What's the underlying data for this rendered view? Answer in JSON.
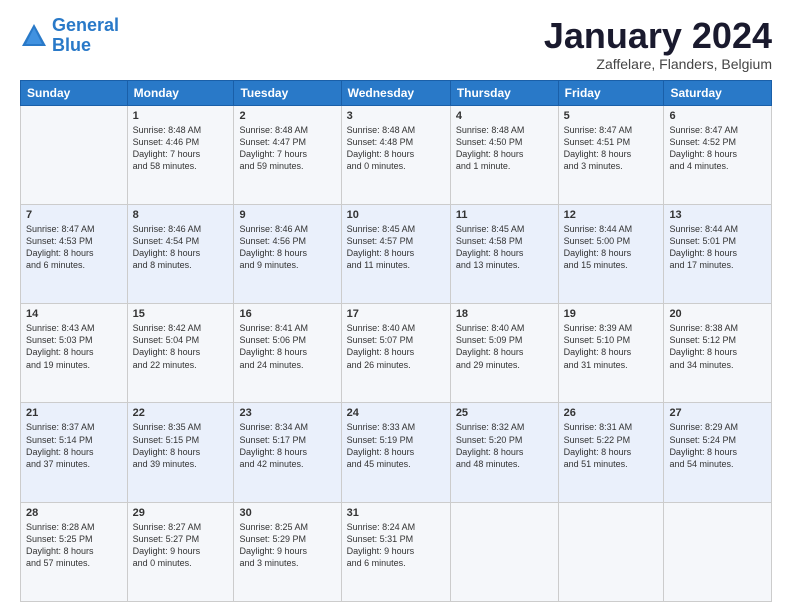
{
  "logo": {
    "line1": "General",
    "line2": "Blue"
  },
  "header": {
    "month": "January 2024",
    "location": "Zaffelare, Flanders, Belgium"
  },
  "weekdays": [
    "Sunday",
    "Monday",
    "Tuesday",
    "Wednesday",
    "Thursday",
    "Friday",
    "Saturday"
  ],
  "weeks": [
    [
      {
        "day": "",
        "info": ""
      },
      {
        "day": "1",
        "info": "Sunrise: 8:48 AM\nSunset: 4:46 PM\nDaylight: 7 hours\nand 58 minutes."
      },
      {
        "day": "2",
        "info": "Sunrise: 8:48 AM\nSunset: 4:47 PM\nDaylight: 7 hours\nand 59 minutes."
      },
      {
        "day": "3",
        "info": "Sunrise: 8:48 AM\nSunset: 4:48 PM\nDaylight: 8 hours\nand 0 minutes."
      },
      {
        "day": "4",
        "info": "Sunrise: 8:48 AM\nSunset: 4:50 PM\nDaylight: 8 hours\nand 1 minute."
      },
      {
        "day": "5",
        "info": "Sunrise: 8:47 AM\nSunset: 4:51 PM\nDaylight: 8 hours\nand 3 minutes."
      },
      {
        "day": "6",
        "info": "Sunrise: 8:47 AM\nSunset: 4:52 PM\nDaylight: 8 hours\nand 4 minutes."
      }
    ],
    [
      {
        "day": "7",
        "info": "Sunrise: 8:47 AM\nSunset: 4:53 PM\nDaylight: 8 hours\nand 6 minutes."
      },
      {
        "day": "8",
        "info": "Sunrise: 8:46 AM\nSunset: 4:54 PM\nDaylight: 8 hours\nand 8 minutes."
      },
      {
        "day": "9",
        "info": "Sunrise: 8:46 AM\nSunset: 4:56 PM\nDaylight: 8 hours\nand 9 minutes."
      },
      {
        "day": "10",
        "info": "Sunrise: 8:45 AM\nSunset: 4:57 PM\nDaylight: 8 hours\nand 11 minutes."
      },
      {
        "day": "11",
        "info": "Sunrise: 8:45 AM\nSunset: 4:58 PM\nDaylight: 8 hours\nand 13 minutes."
      },
      {
        "day": "12",
        "info": "Sunrise: 8:44 AM\nSunset: 5:00 PM\nDaylight: 8 hours\nand 15 minutes."
      },
      {
        "day": "13",
        "info": "Sunrise: 8:44 AM\nSunset: 5:01 PM\nDaylight: 8 hours\nand 17 minutes."
      }
    ],
    [
      {
        "day": "14",
        "info": "Sunrise: 8:43 AM\nSunset: 5:03 PM\nDaylight: 8 hours\nand 19 minutes."
      },
      {
        "day": "15",
        "info": "Sunrise: 8:42 AM\nSunset: 5:04 PM\nDaylight: 8 hours\nand 22 minutes."
      },
      {
        "day": "16",
        "info": "Sunrise: 8:41 AM\nSunset: 5:06 PM\nDaylight: 8 hours\nand 24 minutes."
      },
      {
        "day": "17",
        "info": "Sunrise: 8:40 AM\nSunset: 5:07 PM\nDaylight: 8 hours\nand 26 minutes."
      },
      {
        "day": "18",
        "info": "Sunrise: 8:40 AM\nSunset: 5:09 PM\nDaylight: 8 hours\nand 29 minutes."
      },
      {
        "day": "19",
        "info": "Sunrise: 8:39 AM\nSunset: 5:10 PM\nDaylight: 8 hours\nand 31 minutes."
      },
      {
        "day": "20",
        "info": "Sunrise: 8:38 AM\nSunset: 5:12 PM\nDaylight: 8 hours\nand 34 minutes."
      }
    ],
    [
      {
        "day": "21",
        "info": "Sunrise: 8:37 AM\nSunset: 5:14 PM\nDaylight: 8 hours\nand 37 minutes."
      },
      {
        "day": "22",
        "info": "Sunrise: 8:35 AM\nSunset: 5:15 PM\nDaylight: 8 hours\nand 39 minutes."
      },
      {
        "day": "23",
        "info": "Sunrise: 8:34 AM\nSunset: 5:17 PM\nDaylight: 8 hours\nand 42 minutes."
      },
      {
        "day": "24",
        "info": "Sunrise: 8:33 AM\nSunset: 5:19 PM\nDaylight: 8 hours\nand 45 minutes."
      },
      {
        "day": "25",
        "info": "Sunrise: 8:32 AM\nSunset: 5:20 PM\nDaylight: 8 hours\nand 48 minutes."
      },
      {
        "day": "26",
        "info": "Sunrise: 8:31 AM\nSunset: 5:22 PM\nDaylight: 8 hours\nand 51 minutes."
      },
      {
        "day": "27",
        "info": "Sunrise: 8:29 AM\nSunset: 5:24 PM\nDaylight: 8 hours\nand 54 minutes."
      }
    ],
    [
      {
        "day": "28",
        "info": "Sunrise: 8:28 AM\nSunset: 5:25 PM\nDaylight: 8 hours\nand 57 minutes."
      },
      {
        "day": "29",
        "info": "Sunrise: 8:27 AM\nSunset: 5:27 PM\nDaylight: 9 hours\nand 0 minutes."
      },
      {
        "day": "30",
        "info": "Sunrise: 8:25 AM\nSunset: 5:29 PM\nDaylight: 9 hours\nand 3 minutes."
      },
      {
        "day": "31",
        "info": "Sunrise: 8:24 AM\nSunset: 5:31 PM\nDaylight: 9 hours\nand 6 minutes."
      },
      {
        "day": "",
        "info": ""
      },
      {
        "day": "",
        "info": ""
      },
      {
        "day": "",
        "info": ""
      }
    ]
  ]
}
